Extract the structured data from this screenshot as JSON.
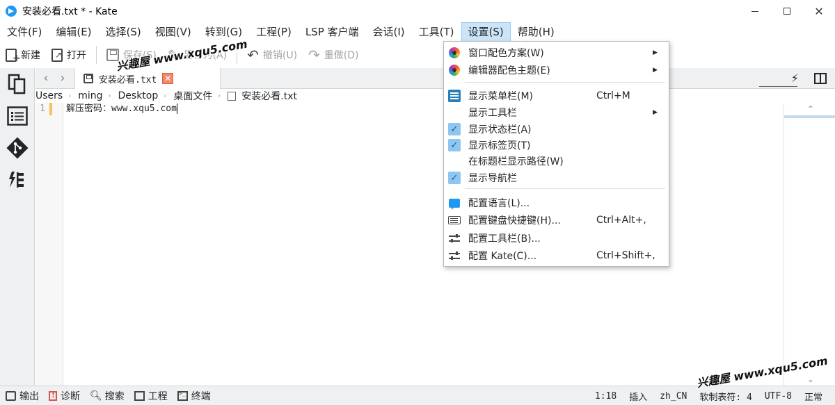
{
  "window": {
    "title": "安装必看.txt * - Kate",
    "controls": [
      "minimize",
      "maximize",
      "close"
    ]
  },
  "menubar": {
    "items": [
      {
        "label": "文件(F)",
        "active": false
      },
      {
        "label": "编辑(E)",
        "active": false
      },
      {
        "label": "选择(S)",
        "active": false
      },
      {
        "label": "视图(V)",
        "active": false
      },
      {
        "label": "转到(G)",
        "active": false
      },
      {
        "label": "工程(P)",
        "active": false
      },
      {
        "label": "LSP 客户端",
        "active": false
      },
      {
        "label": "会话(I)",
        "active": false
      },
      {
        "label": "工具(T)",
        "active": false
      },
      {
        "label": "设置(S)",
        "active": true
      },
      {
        "label": "帮助(H)",
        "active": false
      }
    ]
  },
  "toolbar": {
    "new_label": "新建",
    "open_label": "打开",
    "save_label": "保存(S)",
    "save_as_label": "另存为(A)",
    "undo_label": "撤销(U)",
    "redo_label": "重做(D)"
  },
  "tabbar": {
    "tab_label": "安装必看.txt",
    "close_glyph": "✕"
  },
  "breadcrumb": {
    "parts": [
      "Users",
      "ming",
      "Desktop",
      "桌面文件"
    ],
    "file": "安装必看.txt"
  },
  "editor": {
    "line_number": "1",
    "line_text": "解压密码：www.xqu5.com"
  },
  "statusbar": {
    "output_label": "输出",
    "diagnostics_label": "诊断",
    "search_label": "搜索",
    "project_label": "工程",
    "terminal_label": "终端",
    "position": "1:18",
    "mode": "插入",
    "language": "zh_CN",
    "indent": "软制表符: 4",
    "encoding": "UTF-8",
    "syntax": "正常"
  },
  "watermark": {
    "text": "兴趣屋 www.xqu5.com"
  },
  "settings_menu": {
    "items": [
      {
        "label": "窗口配色方案(W)",
        "icon": "color-palette-icon",
        "submenu": true,
        "shortcut": ""
      },
      {
        "label": "编辑器配色主题(E)",
        "icon": "color-palette-icon",
        "submenu": true,
        "shortcut": ""
      },
      {
        "label": "显示菜单栏(M)",
        "icon": "menubar-icon",
        "submenu": false,
        "shortcut": "Ctrl+M"
      },
      {
        "label": "显示工具栏",
        "icon": "",
        "submenu": true,
        "shortcut": ""
      },
      {
        "label": "显示状态栏(A)",
        "icon": "checkmark-icon",
        "checked": true,
        "submenu": false,
        "shortcut": ""
      },
      {
        "label": "显示标签页(T)",
        "icon": "checkmark-icon",
        "checked": true,
        "submenu": false,
        "shortcut": ""
      },
      {
        "label": "在标题栏显示路径(W)",
        "icon": "",
        "submenu": false,
        "shortcut": ""
      },
      {
        "label": "显示导航栏",
        "icon": "checkmark-icon",
        "checked": true,
        "submenu": false,
        "shortcut": ""
      },
      {
        "label": "配置语言(L)...",
        "icon": "language-icon",
        "submenu": false,
        "shortcut": ""
      },
      {
        "label": "配置键盘快捷键(H)...",
        "icon": "keyboard-icon",
        "submenu": false,
        "shortcut": "Ctrl+Alt+,"
      },
      {
        "label": "配置工具栏(B)...",
        "icon": "sliders-icon",
        "submenu": false,
        "shortcut": ""
      },
      {
        "label": "配置 Kate(C)...",
        "icon": "sliders-icon",
        "submenu": false,
        "shortcut": "Ctrl+Shift+,"
      }
    ]
  },
  "colors": {
    "menu_highlight": "#cce4f7",
    "check_bg": "#8ec6f2",
    "panel_bg": "#eff0f1",
    "modified_marker": "#f6c25b",
    "tab_close_bg": "#f2886e"
  }
}
